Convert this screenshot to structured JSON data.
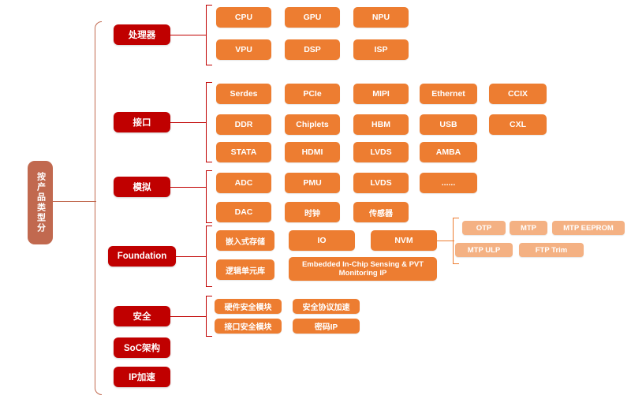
{
  "diagram": {
    "root": {
      "label": "按产品类型分"
    },
    "colors": {
      "root": "#C1694F",
      "level1": "#C00000",
      "leaf": "#ED7D31",
      "leaf_pale": "#F4B183",
      "text": "#FFFFFF"
    },
    "branches": [
      {
        "id": "processor",
        "label": "处理器",
        "rows": [
          [
            "CPU",
            "GPU",
            "NPU"
          ],
          [
            "VPU",
            "DSP",
            "ISP"
          ]
        ]
      },
      {
        "id": "interface",
        "label": "接口",
        "rows": [
          [
            "Serdes",
            "PCIe",
            "MIPI",
            "Ethernet",
            "CCIX"
          ],
          [
            "DDR",
            "Chiplets",
            "HBM",
            "USB",
            "CXL"
          ],
          [
            "STATA",
            "HDMI",
            "LVDS",
            "AMBA"
          ]
        ]
      },
      {
        "id": "analog",
        "label": "模拟",
        "rows": [
          [
            "ADC",
            "PMU",
            "LVDS",
            "......"
          ],
          [
            "DAC",
            "时钟",
            "传感器"
          ]
        ]
      },
      {
        "id": "foundation",
        "label": "Foundation",
        "rows": [
          [
            "嵌入式存储",
            "IO",
            "NVM"
          ],
          [
            "逻辑单元库",
            "Embedded In-Chip Sensing & PVT Monitoring IP"
          ]
        ],
        "sub": {
          "parent": "NVM",
          "rows": [
            [
              "OTP",
              "MTP",
              "MTP EEPROM"
            ],
            [
              "MTP ULP",
              "FTP Trim"
            ]
          ]
        }
      },
      {
        "id": "security",
        "label": "安全",
        "rows": [
          [
            "硬件安全模块",
            "安全协议加速"
          ],
          [
            "接口安全模块",
            "密码IP"
          ]
        ]
      },
      {
        "id": "soc-architecture",
        "label": "SoC架构",
        "rows": []
      },
      {
        "id": "ip-acceleration",
        "label": "IP加速",
        "rows": []
      }
    ]
  }
}
